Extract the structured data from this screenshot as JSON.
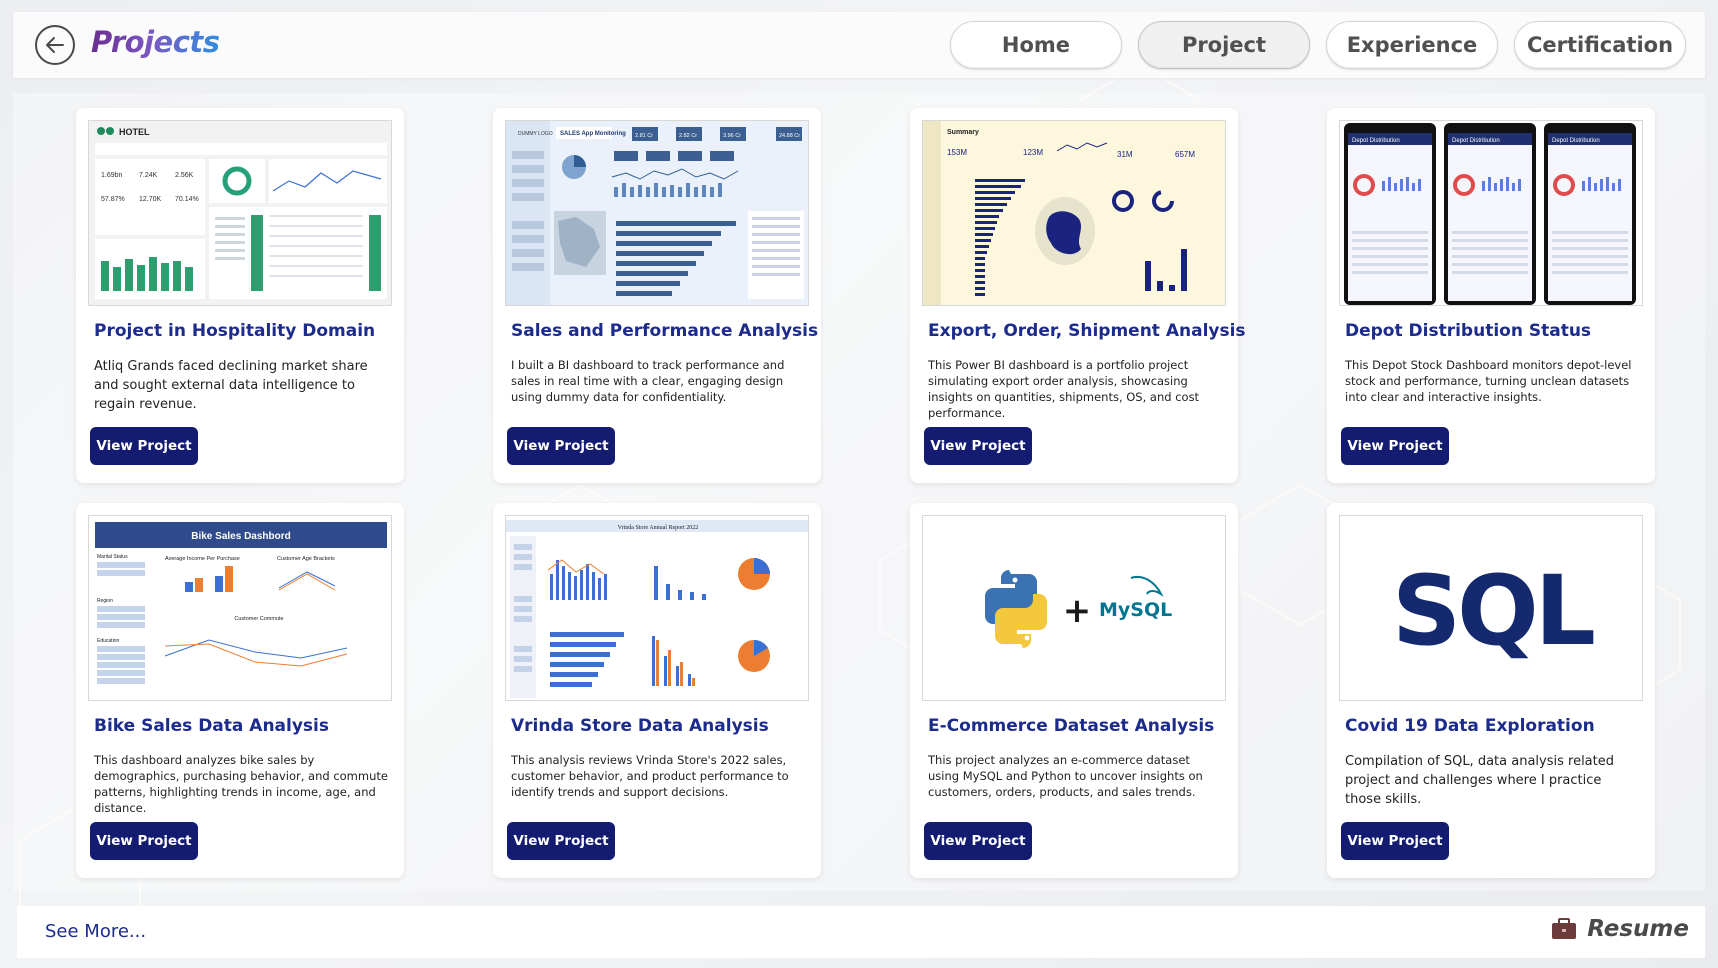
{
  "header": {
    "title": "Projects",
    "nav": [
      "Home",
      "Project",
      "Experience",
      "Certification"
    ],
    "active_nav": "Project"
  },
  "projects": [
    {
      "title": "Project in Hospitality Domain",
      "description": "Atliq Grands faced declining market share and sought external data intelligence to regain revenue.",
      "button": "View Project",
      "thumbnail": {
        "heading": "HOTEL",
        "kpis": [
          "1.69bn",
          "7.24K",
          "2.56K",
          "57.87%",
          "12.70K",
          "70.14%"
        ]
      }
    },
    {
      "title": "Sales and Performance Analysis",
      "description": "I built a BI dashboard to track performance and sales in real time with a clear, engaging design using dummy data for confidentiality.",
      "button": "View Project",
      "thumbnail": {
        "heading": "SALES App Monitoring",
        "logo": "DUMMY LOGO",
        "kpis": [
          "2.81 Cr",
          "2.82 Cr",
          "3.96 Cr",
          "24.88 Cr"
        ]
      }
    },
    {
      "title": "Export, Order, Shipment Analysis",
      "description": "This Power BI dashboard is a portfolio project simulating export order analysis, showcasing insights on quantities, shipments, OS, and cost performance.",
      "button": "View Project",
      "thumbnail": {
        "heading": "Summary",
        "kpis": [
          "153M",
          "123M",
          "31M",
          "657M"
        ]
      }
    },
    {
      "title": "Depot Distribution Status",
      "description": "This Depot Stock Dashboard monitors depot-level stock and performance, turning unclean datasets into clear and interactive insights.",
      "button": "View Project",
      "thumbnail": {
        "heading": "Depot Distribution"
      }
    },
    {
      "title": "Bike Sales Data Analysis",
      "description": "This dashboard analyzes bike sales by demographics, purchasing behavior, and commute patterns, highlighting trends in income, age, and distance.",
      "button": "View Project",
      "thumbnail": {
        "heading": "Bike Sales Dashbord",
        "panels": [
          "Average Income Per Purchase",
          "Customer Age Brackets",
          "Customer Commute"
        ],
        "filters": [
          "Marital Status",
          "Region",
          "Education"
        ]
      }
    },
    {
      "title": "Vrinda Store Data Analysis",
      "description": "This analysis reviews Vrinda Store's 2022 sales, customer behavior, and product performance to identify trends and support decisions.",
      "button": "View Project",
      "thumbnail": {
        "heading": "Vrinda Store Annual Report 2022"
      }
    },
    {
      "title": "E-Commerce Dataset Analysis",
      "description": "This project analyzes an e-commerce dataset using MySQL and Python to uncover insights on customers, orders, products, and sales trends.",
      "button": "View Project",
      "thumbnail": {
        "plus": "+",
        "logo_text": "MySQL"
      }
    },
    {
      "title": "Covid 19 Data Exploration",
      "description": "Compilation of SQL, data analysis related project and challenges where I practice those skills.",
      "button": "View Project",
      "thumbnail": {
        "logo_text": "SQL"
      }
    }
  ],
  "footer": {
    "see_more": "See More...",
    "resume": "Resume"
  },
  "colors": {
    "accent": "#141c72",
    "title": "#1c2b8c",
    "brand_gradient_start": "#6a2d8f",
    "brand_gradient_end": "#2f8fe0"
  },
  "icons": {
    "back": "arrow-left-circle-icon",
    "resume": "briefcase-icon"
  }
}
